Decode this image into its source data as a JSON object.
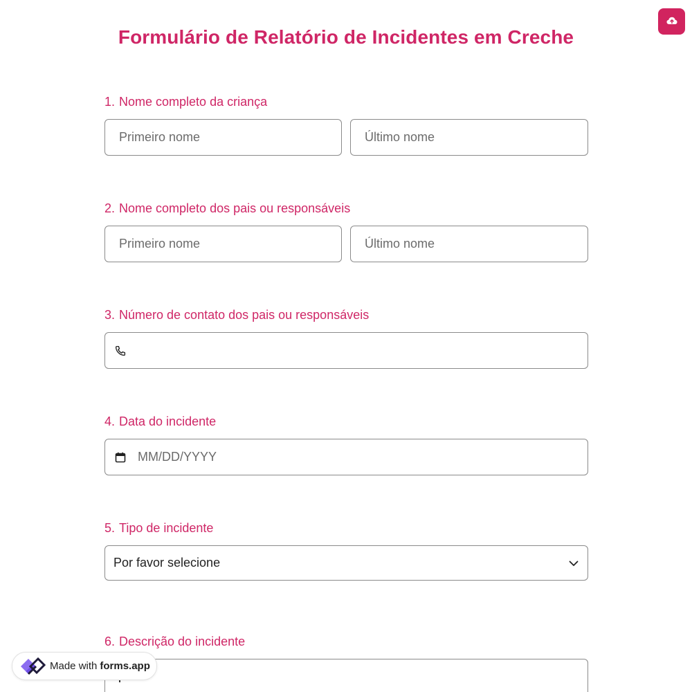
{
  "header": {
    "title": "Formulário de Relatório de Incidentes em Creche",
    "upload_icon": "cloud-upload-icon",
    "accent_color": "#d1245f"
  },
  "questions": [
    {
      "number": "1.",
      "label": "Nome completo da criança",
      "first_placeholder": "Primeiro nome",
      "last_placeholder": "Último nome"
    },
    {
      "number": "2.",
      "label": "Nome completo dos pais ou responsáveis",
      "first_placeholder": "Primeiro nome",
      "last_placeholder": "Último nome"
    },
    {
      "number": "3.",
      "label": "Número de contato dos pais ou responsáveis",
      "icon": "phone-icon"
    },
    {
      "number": "4.",
      "label": "Data do incidente",
      "placeholder": "MM/DD/YYYY",
      "icon": "calendar-icon"
    },
    {
      "number": "5.",
      "label": "Tipo de incidente",
      "selected": "Por favor selecione",
      "icon": "chevron-down-icon"
    },
    {
      "number": "6.",
      "label": "Descrição do incidente"
    }
  ],
  "footer": {
    "made_with": "Made with",
    "brand": "forms.app",
    "logo_icon": "forms-app-logo-icon"
  }
}
